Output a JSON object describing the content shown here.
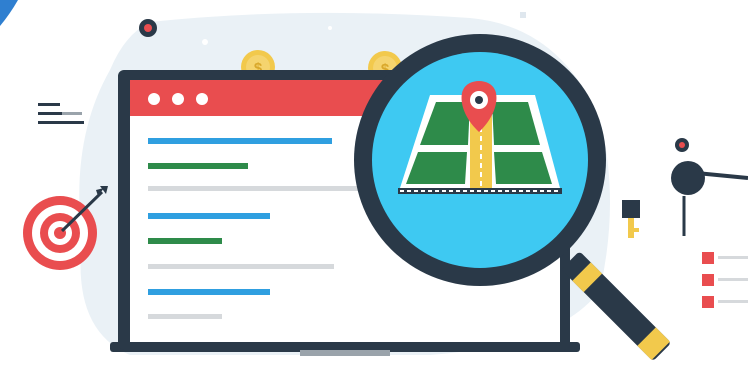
{
  "illustration": {
    "subject": "local-seo-map-search",
    "icons": [
      "target-icon",
      "browser-window-icon",
      "magnifying-glass-icon",
      "map-icon",
      "location-pin-icon",
      "dollar-coin-icon",
      "key-icon",
      "checklist-icon",
      "text-lines-icon"
    ]
  },
  "browser": {
    "dot_count": 3
  },
  "colors": {
    "navy": "#2a3948",
    "red": "#e94d4f",
    "blue": "#2f9fe0",
    "cyan": "#3ec9f2",
    "green": "#2e8b4a",
    "yellow": "#f2c94c",
    "gray_line": "#d6d9dc",
    "bg_blob": "#eaf1f6"
  }
}
